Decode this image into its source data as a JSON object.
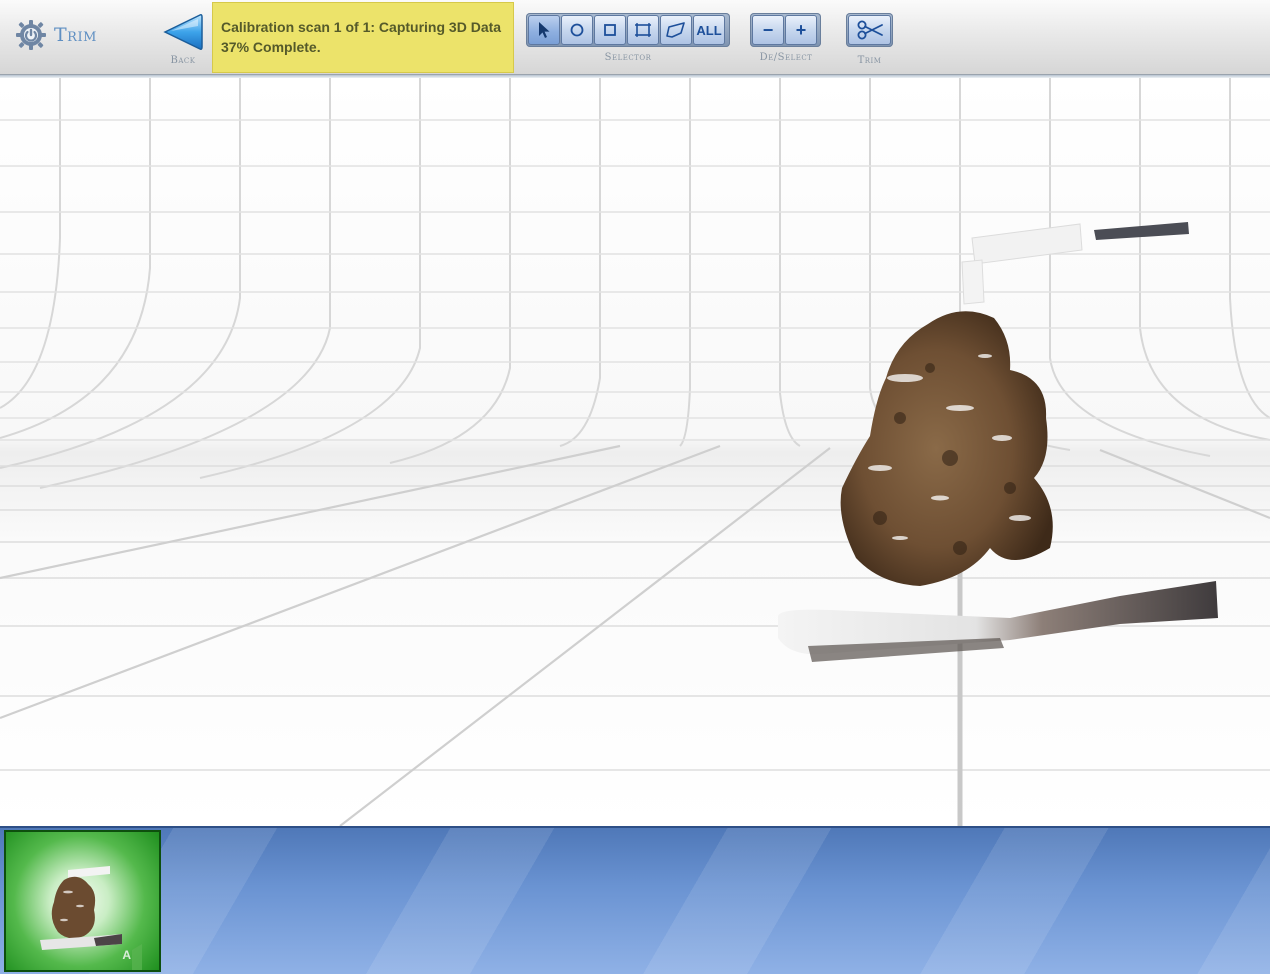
{
  "app": {
    "title": "Trim"
  },
  "toolbar": {
    "back_label": "Back",
    "status": {
      "line1": "Calibration scan 1 of 1: Capturing 3D Data",
      "line2": "37% Complete."
    },
    "selector": {
      "label": "Selector",
      "tools": [
        {
          "name": "pointer",
          "icon": "pointer-icon",
          "active": true
        },
        {
          "name": "circle",
          "icon": "circle-select-icon"
        },
        {
          "name": "square",
          "icon": "square-select-icon"
        },
        {
          "name": "rectangle",
          "icon": "rectangle-select-icon"
        },
        {
          "name": "polygon",
          "icon": "polygon-select-icon"
        },
        {
          "name": "all",
          "text": "ALL"
        }
      ]
    },
    "deselect": {
      "label": "De/Select",
      "minus": "−",
      "plus": "+"
    },
    "trim": {
      "label": "Trim",
      "icon": "scissors-icon"
    }
  },
  "thumbnail": {
    "letter": "A"
  },
  "colors": {
    "accent": "#5f8fc2",
    "status_bg": "#ece36a",
    "strip_blue": "#6a93d2",
    "thumb_green": "#1f8f1f"
  }
}
